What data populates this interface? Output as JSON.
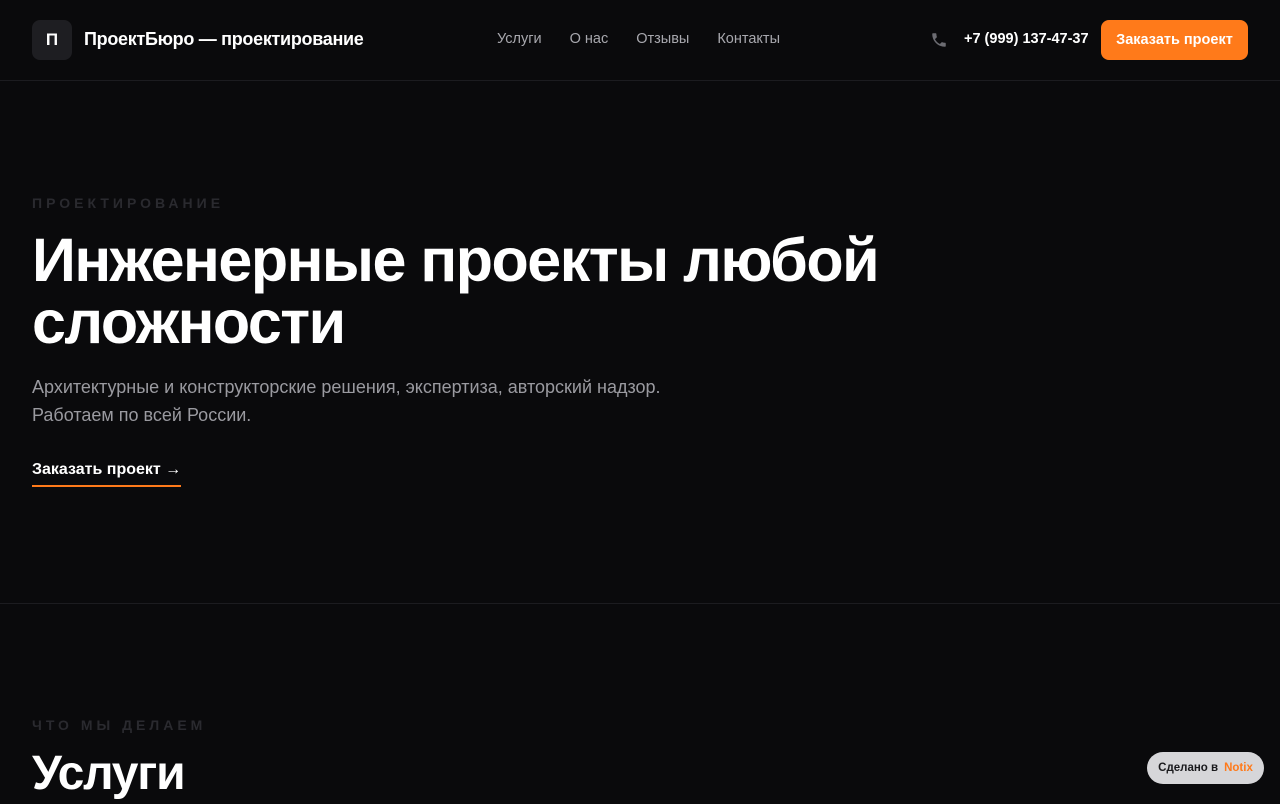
{
  "header": {
    "logo_letter": "П",
    "brand": "ПроектБюро — проектирование",
    "nav": [
      "Услуги",
      "О нас",
      "Отзывы",
      "Контакты"
    ],
    "phone": "+7 (999) 137-47-37",
    "phone_icon": "phone-icon",
    "cta_label": "Заказать проект"
  },
  "hero": {
    "eyebrow": "ПРОЕКТИРОВАНИЕ",
    "title": "Инженерные проекты любой сложности",
    "subtitle_line1": "Архитектурные и конструкторские решения, экспертиза, авторский надзор.",
    "subtitle_line2": "Работаем по всей России.",
    "link_label": "Заказать проект →"
  },
  "services": {
    "eyebrow": "ЧТО МЫ ДЕЛАЕМ",
    "title": "Услуги"
  },
  "badge": {
    "made_label": "Сделано в",
    "brand": "Notix"
  },
  "colors": {
    "accent": "#ff7a1a",
    "background": "#0a0a0c",
    "text_muted": "#9a9aa0"
  }
}
